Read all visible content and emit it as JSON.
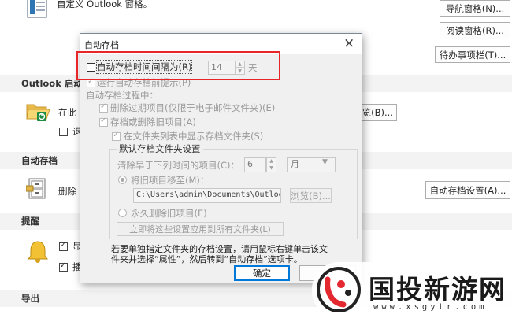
{
  "background": {
    "top_text": "自定义 Outlook 窗格。",
    "nav_pane_button": "导航窗格(N)...",
    "reading_pane_button": "阅读窗格(R)...",
    "todo_bar_button": "待办事项栏(T)...",
    "startup_section": "Outlook 启动",
    "startup_text": "在此",
    "startup_checkbox_label": "退",
    "browse_button": "览(B)...",
    "autoarchive_section": "自动存档",
    "autoarchive_text": "删除",
    "autoarchive_settings_button": "自动存档设置(A)...",
    "reminders_section": "提醒",
    "reminder_1": "显",
    "reminder_2": "播",
    "export_section": "导出"
  },
  "dialog": {
    "title": "自动存档",
    "run_every_label": "自动存档时间间隔为(R)",
    "interval_value": "14",
    "interval_unit": "天",
    "prompt_label": "运行自动存档前提示(P)",
    "during_label": "自动存档过程中：",
    "delete_expired_label": "删除过期项目(仅限于电子邮件文件夹)(E)",
    "archive_or_delete_label": "存档或删除旧项目(A)",
    "show_folder_label": "在文件夹列表中显示存档文件夹(S)",
    "group_title": "默认存档文件夹设置",
    "clean_older_label": "清除早于下列时间的项目(C)：",
    "age_value": "6",
    "age_unit": "月",
    "move_label": "将旧项目移至(M)：",
    "path_value": "C:\\Users\\admin\\Documents\\Outloo",
    "browse_button": "浏览(B)...",
    "permanent_delete_label": "永久删除旧项目(E)",
    "apply_all_button": "立即将这些设置应用到所有文件夹(L)",
    "note_text_line1": "若要单独指定文件夹的存档设置，请用鼠标右键单击该文",
    "note_text_line2": "件夹并选择“属性”，然后转到“自动存档”选项卡。",
    "ok_button": "确定",
    "close_glyph": "×"
  },
  "watermark": {
    "text": "国投新游网",
    "url": "www.xsgytr.com"
  },
  "colors": {
    "highlight_box": "#e8262a",
    "section_bg": "#f3f3f3",
    "dialog_bg": "#f0f0f0",
    "watermark_red": "#e3282f"
  }
}
